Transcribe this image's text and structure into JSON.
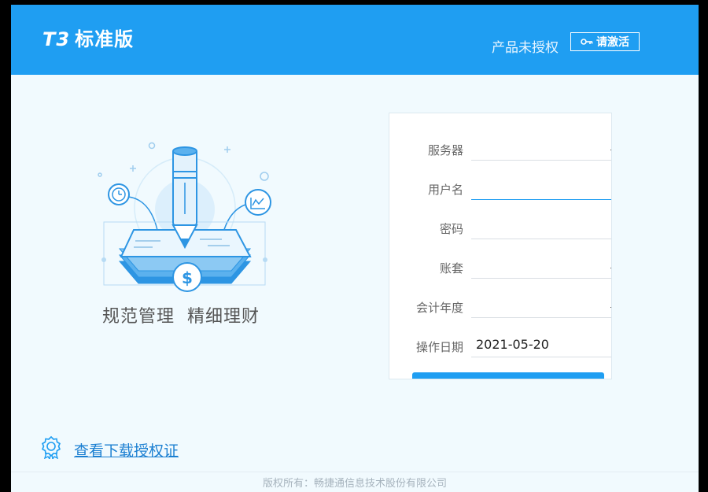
{
  "header": {
    "logo_prefix": "T3",
    "logo_text": "标准版",
    "license_status": "产品未授权",
    "activate_label": "请激活",
    "activate_icon": "key-icon"
  },
  "illustration": {
    "slogan_left": "规范管理",
    "slogan_right": "精细理财",
    "coin_symbol": "$"
  },
  "login_form": {
    "fields": [
      {
        "label": "服务器",
        "value": ""
      },
      {
        "label": "用户名",
        "value": ""
      },
      {
        "label": "密码",
        "value": ""
      },
      {
        "label": "账套",
        "value": ""
      },
      {
        "label": "会计年度",
        "value": ""
      },
      {
        "label": "操作日期",
        "value": "2021-05-20"
      }
    ]
  },
  "certificate": {
    "link_label": "查看下载授权证",
    "icon": "certificate-icon"
  },
  "footer": {
    "copyright": "版权所有：畅捷通信息技术股份有限公司"
  },
  "colors": {
    "brand": "#1f9ef2",
    "background": "#f1fafe",
    "link": "#1b7fd1"
  }
}
